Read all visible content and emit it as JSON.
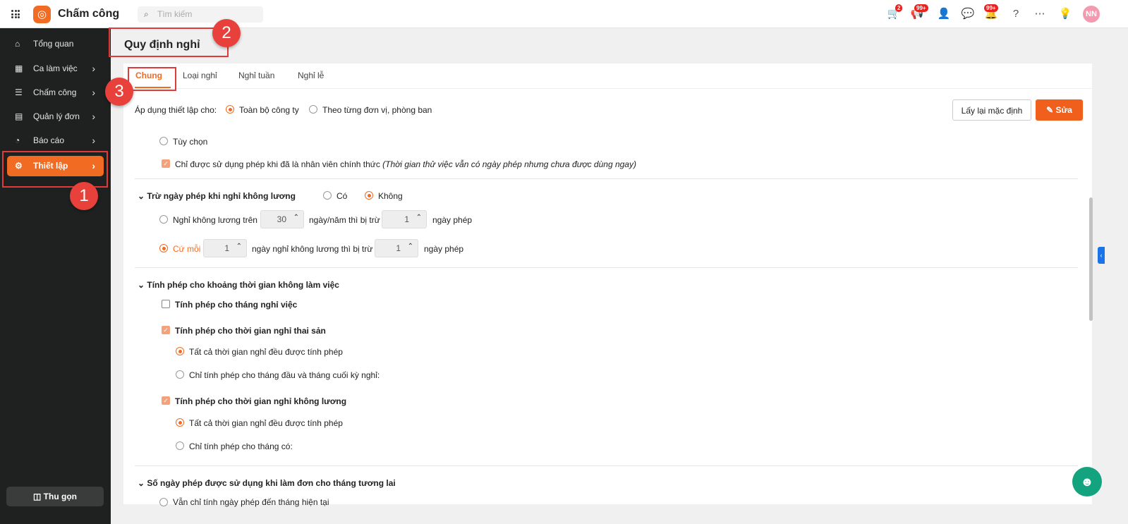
{
  "app": {
    "title": "Chấm công",
    "search_placeholder": "Tìm kiếm",
    "avatar": "NN",
    "badges": {
      "cart": "2",
      "megaphone": "99+",
      "bell": "99+"
    }
  },
  "sidebar": {
    "items": [
      {
        "label": "Tổng quan"
      },
      {
        "label": "Ca làm việc"
      },
      {
        "label": "Chấm công"
      },
      {
        "label": "Quản lý đơn"
      },
      {
        "label": "Báo cáo"
      },
      {
        "label": "Thiết lập"
      }
    ],
    "collapse": "Thu gọn"
  },
  "page": {
    "title": "Quy định nghỉ",
    "tabs": [
      "Chung",
      "Loại nghỉ",
      "Nghỉ tuần",
      "Nghỉ lễ"
    ]
  },
  "apply": {
    "label": "Áp dụng thiết lập cho:",
    "opt1": "Toàn bộ công ty",
    "opt2": "Theo từng đơn vị, phòng ban",
    "reset": "Lấy lại mặc định",
    "edit": "Sửa"
  },
  "s0": {
    "custom": "Tùy chọn",
    "official": "Chỉ được sử dụng phép khi đã là nhân viên chính thức",
    "official_note": "(Thời gian thử việc vẫn có ngày phép nhưng chưa được dùng ngay)"
  },
  "s1": {
    "title": "Trừ ngày phép khi nghỉ không lương",
    "yes": "Có",
    "no": "Không",
    "r1a": "Nghỉ không lương trên",
    "r1v1": "30",
    "r1b": "ngày/năm thì bị trừ",
    "r1v2": "1",
    "r1c": "ngày phép",
    "r2a": "Cứ mỗi",
    "r2v1": "1",
    "r2b": "ngày nghỉ không lương thì bị trừ",
    "r2v2": "1",
    "r2c": "ngày phép"
  },
  "s2": {
    "title": "Tính phép cho khoảng thời gian không làm việc",
    "c1": "Tính phép cho tháng nghỉ việc",
    "c2": "Tính phép cho thời gian nghỉ thai sản",
    "c2a": "Tất cả thời gian nghỉ đều được tính phép",
    "c2b": "Chỉ tính phép cho tháng đầu và tháng cuối kỳ nghỉ:",
    "c3": "Tính phép cho thời gian nghỉ không lương",
    "c3a": "Tất cả thời gian nghỉ đều được tính phép",
    "c3b": "Chỉ tính phép cho tháng có:"
  },
  "s3": {
    "title": "Số ngày phép được sử dụng khi làm đơn cho tháng tương lai",
    "r1": "Vẫn chỉ tính ngày phép đến tháng hiện tại"
  },
  "annotations": [
    "1",
    "2",
    "3"
  ]
}
